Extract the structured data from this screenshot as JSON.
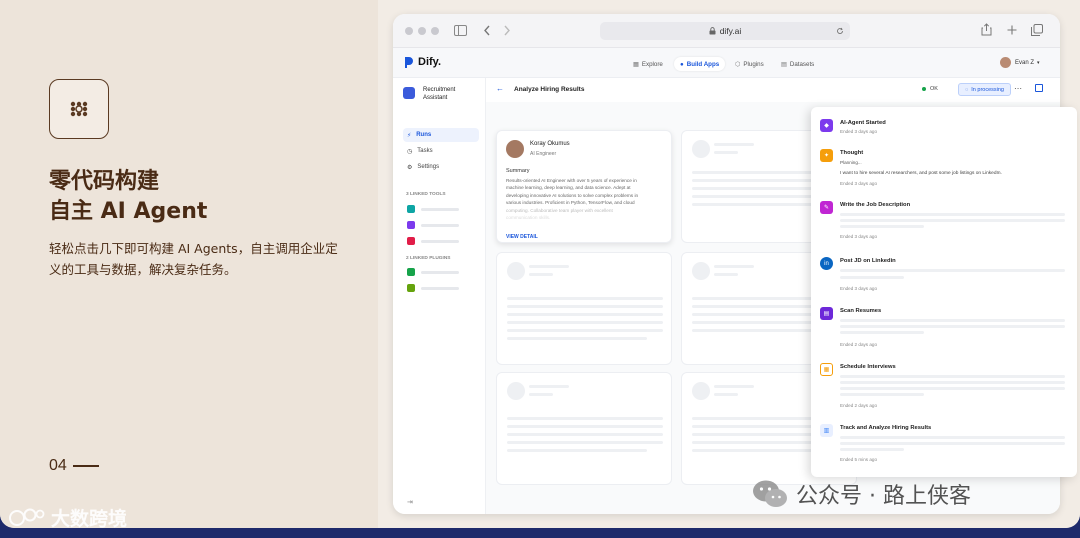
{
  "slide": {
    "headline_line1": "零代码构建",
    "headline_line2": "自主 AI Agent",
    "description": "轻松点击几下即可构建 AI Agents，自主调用企业定义的工具与数据，解决复杂任务。",
    "page_number": "04",
    "watermark_left": "大数跨境",
    "watermark_right": "公众号 · 路上侠客",
    "colors": {
      "text": "#4a2b15",
      "background": "#ede4da",
      "accent_blue": "#1a56db"
    }
  },
  "browser": {
    "url": "dify.ai"
  },
  "app": {
    "brand": "Dify.",
    "nav": [
      {
        "label": "Explore",
        "icon": "compass-icon"
      },
      {
        "label": "Build Apps",
        "icon": "apps-icon"
      },
      {
        "label": "Plugins",
        "icon": "plugin-icon"
      },
      {
        "label": "Datasets",
        "icon": "database-icon"
      }
    ],
    "user_name": "Evan Z"
  },
  "sidebar": {
    "app_name": "Recruitment Assistant",
    "items": [
      {
        "label": "Runs",
        "icon": "bolt-icon"
      },
      {
        "label": "Tasks",
        "icon": "clock-icon"
      },
      {
        "label": "Settings",
        "icon": "gear-icon"
      }
    ],
    "tools_label": "3 LINKED TOOLS",
    "plugins_label": "2 LINKED PLUGINS"
  },
  "main": {
    "title": "Analyze Hiring Results",
    "status_ok": "OK",
    "status_processing": "In processing",
    "candidate": {
      "name": "Koray Okumus",
      "role": "AI Engineer",
      "section": "Summary",
      "summary_lines": [
        "Results-oriented AI Engineer with over 5 years of experience in",
        "machine learning, deep learning, and data science. Adept at",
        "developing innovative AI solutions to solve complex problems in",
        "various industries. Proficient in Python, TensorFlow, and cloud",
        "computing. Collaborative team player with excellent",
        "communication skills."
      ],
      "link": "VIEW DETAIL"
    }
  },
  "drawer": {
    "steps": [
      {
        "title": "AI-Agent Started",
        "time": "Ended 3 days ago",
        "color": "#7c3aed"
      },
      {
        "title": "Thought",
        "status": "Planning...",
        "text": "I want to hire several AI researchers, and post some job listings on LinkedIn.",
        "time": "Ended 3 days ago",
        "color": "#f59e0b"
      },
      {
        "title": "Write the Job Description",
        "time": "Ended 3 days ago",
        "color": "#c026d3"
      },
      {
        "title": "Post JD on Linkedin",
        "time": "Ended 3 days ago",
        "color": "#0a66c2"
      },
      {
        "title": "Scan Resumes",
        "time": "Ended 2 days ago",
        "color": "#6d28d9"
      },
      {
        "title": "Schedule Interviews",
        "time": "Ended 2 days ago",
        "color": "#f59e0b"
      },
      {
        "title": "Track and Analyze Hiring Results",
        "time": "Ended 5 mins ago",
        "color": "#3b82f6"
      }
    ]
  }
}
